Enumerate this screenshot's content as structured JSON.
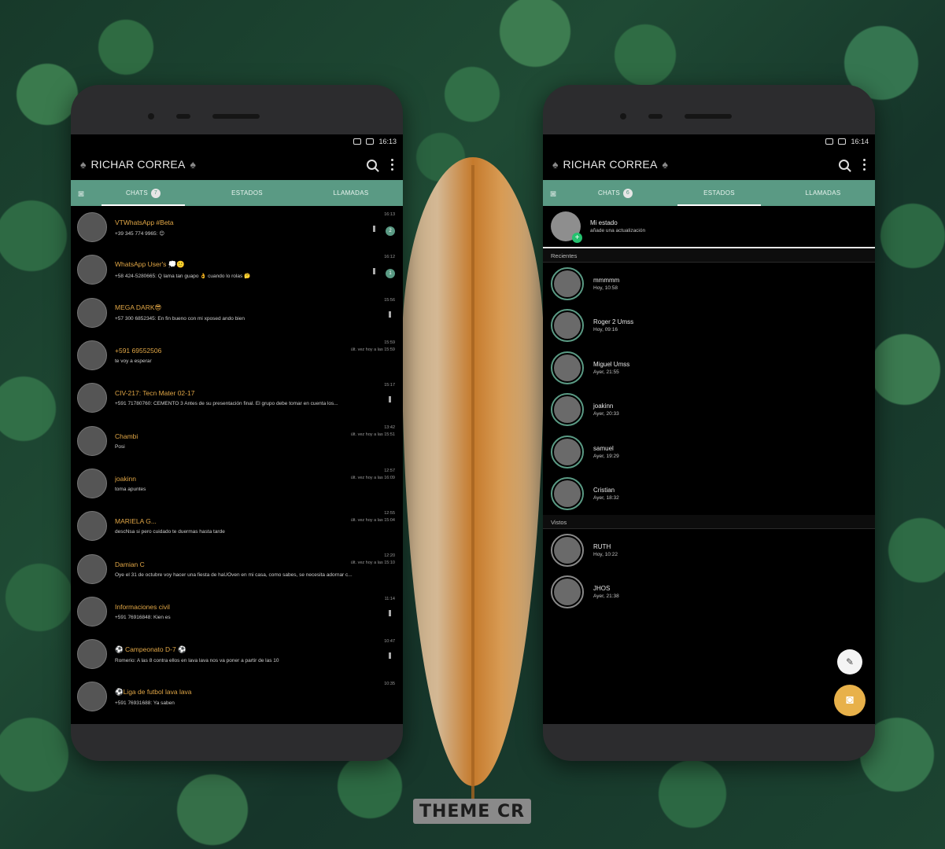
{
  "watermark": "THEME CR",
  "left_phone": {
    "status_time": "16:13",
    "title": "RICHAR CORREA",
    "tabs": [
      {
        "label": "CHATS",
        "count": "7"
      },
      {
        "label": "ESTADOS"
      },
      {
        "label": "LLAMADAS"
      }
    ],
    "chats": [
      {
        "name": "VTWhatsApp #Beta",
        "msg": "+39 345 774 9965: 😊",
        "time": "16:13",
        "sub": "",
        "badge": "2",
        "muted": true
      },
      {
        "name": "WhatsApp User's 💭🙂",
        "msg": "+58 424-5280665: Q lama tan guapo 👌 cuando lo rolas 🤔",
        "time": "16:12",
        "sub": "",
        "badge": "1",
        "muted": true
      },
      {
        "name": "MEGA DARK😎",
        "msg": "+57 300 6852345: En fin bueno con mi xposed ando bien",
        "time": "15:56",
        "sub": "",
        "badge": "",
        "muted": true
      },
      {
        "name": "+591 69552506",
        "msg": "te voy a esperar",
        "time": "15:59",
        "sub": "últ. vez hoy a las 15:59",
        "badge": "",
        "muted": false
      },
      {
        "name": "CIV-217: Tecn Mater 02-17",
        "msg": "+591 71780760: CEMENTO 3     Antes de su presentación final. El grupo debe tomar en cuenta los...",
        "time": "15:17",
        "sub": "",
        "badge": "",
        "muted": true
      },
      {
        "name": "Chambi",
        "msg": "Posi",
        "time": "13:42",
        "sub": "últ. vez hoy a las 15:51",
        "badge": "",
        "muted": false
      },
      {
        "name": "joakinn",
        "msg": "toma apuntes",
        "time": "12:57",
        "sub": "últ. vez hoy a las 16:09",
        "badge": "",
        "muted": false
      },
      {
        "name": "MARIELA G...",
        "msg": "descNsa si pero cuidado te duermas hasta tarde",
        "time": "12:55",
        "sub": "últ. vez hoy a las 15:04",
        "badge": "",
        "muted": false
      },
      {
        "name": "Damian C",
        "msg": "Oye el 31 de octubre voy hacer una fiesta de haUOven en mi casa, como sabes, se necesita adornar c...",
        "time": "12:20",
        "sub": "últ. vez hoy a las 15:10",
        "badge": "",
        "muted": false
      },
      {
        "name": "Informaciones civil",
        "msg": "+591 76916848: Kien es",
        "time": "11:14",
        "sub": "",
        "badge": "",
        "muted": true
      },
      {
        "name": "⚽ Campeonato D-7 ⚽",
        "msg": "Romerio: A las 8 contra ellos en lava lava nos va poner a partir de las 10",
        "time": "10:47",
        "sub": "",
        "badge": "",
        "muted": true
      },
      {
        "name": "⚽Liga de futbol lava lava",
        "msg": "+591 76931688: Ya saben",
        "time": "10:35",
        "sub": "",
        "badge": "",
        "muted": false
      }
    ]
  },
  "right_phone": {
    "status_time": "16:14",
    "title": "RICHAR CORREA",
    "tabs": [
      {
        "label": "CHATS",
        "count": "6"
      },
      {
        "label": "ESTADOS"
      },
      {
        "label": "LLAMADAS"
      }
    ],
    "my_status": {
      "name": "Mi estado",
      "sub": "añade una actualización"
    },
    "recent_label": "Recientes",
    "recent": [
      {
        "name": "mmmmm",
        "time": "Hoy, 10:58"
      },
      {
        "name": "Roger 2 Umss",
        "time": "Hoy, 09:16"
      },
      {
        "name": "Miguel Umss",
        "time": "Ayer, 21:55"
      },
      {
        "name": "joakinn",
        "time": "Ayer, 20:33"
      },
      {
        "name": "samuel",
        "time": "Ayer, 19:29"
      },
      {
        "name": "Cristian",
        "time": "Ayer, 18:32"
      }
    ],
    "seen_label": "Vistos",
    "seen": [
      {
        "name": "RUTH",
        "time": "Hoy, 10:22"
      },
      {
        "name": "JHOS",
        "time": "Ayer, 21:38"
      }
    ]
  }
}
